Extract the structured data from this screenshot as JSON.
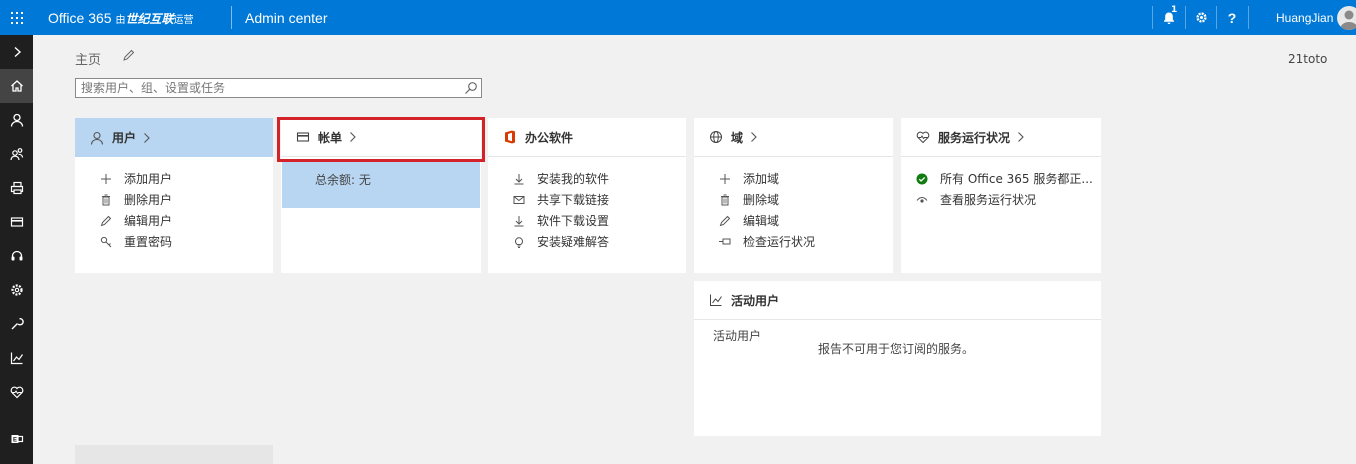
{
  "topbar": {
    "brand": "Office 365",
    "brand_partner_prefix": "由",
    "brand_partner": "世纪互联",
    "brand_partner_suffix": "运营",
    "app_title": "Admin center",
    "notification_count": "1",
    "user_name": "HuangJian"
  },
  "nav": {
    "items": [
      "expand-icon",
      "home-icon",
      "user-icon",
      "groups-icon",
      "resources-icon",
      "billing-icon",
      "support-icon",
      "settings-icon",
      "setup-icon",
      "reports-icon",
      "health-icon",
      "admin-centers-icon"
    ],
    "active": "home-icon"
  },
  "page": {
    "breadcrumb": "主页",
    "tenant": "21toto",
    "search_placeholder": "搜索用户、组、设置或任务"
  },
  "cards": {
    "users": {
      "title": "用户",
      "links": [
        "添加用户",
        "删除用户",
        "编辑用户",
        "重置密码"
      ]
    },
    "billing": {
      "title": "帐单",
      "balance": "总余额: 无"
    },
    "office": {
      "title": "办公软件",
      "links": [
        "安装我的软件",
        "共享下载链接",
        "软件下载设置",
        "安装疑难解答"
      ]
    },
    "domains": {
      "title": "域",
      "links": [
        "添加域",
        "删除域",
        "编辑域",
        "检查运行状况"
      ]
    },
    "health": {
      "title": "服务运行状况",
      "links": [
        "所有 Office 365 服务都正...",
        "查看服务运行状况"
      ]
    },
    "active_users": {
      "title": "活动用户",
      "label": "活动用户",
      "message": "报告不可用于您订阅的服务。"
    }
  },
  "colors": {
    "topbar": "#0078d7",
    "rail": "#1f1f1f",
    "selected_tile": "#b8d6f2",
    "highlight_border": "#d3222a",
    "ok_green": "#107c10",
    "office_orange": "#d83b01"
  }
}
